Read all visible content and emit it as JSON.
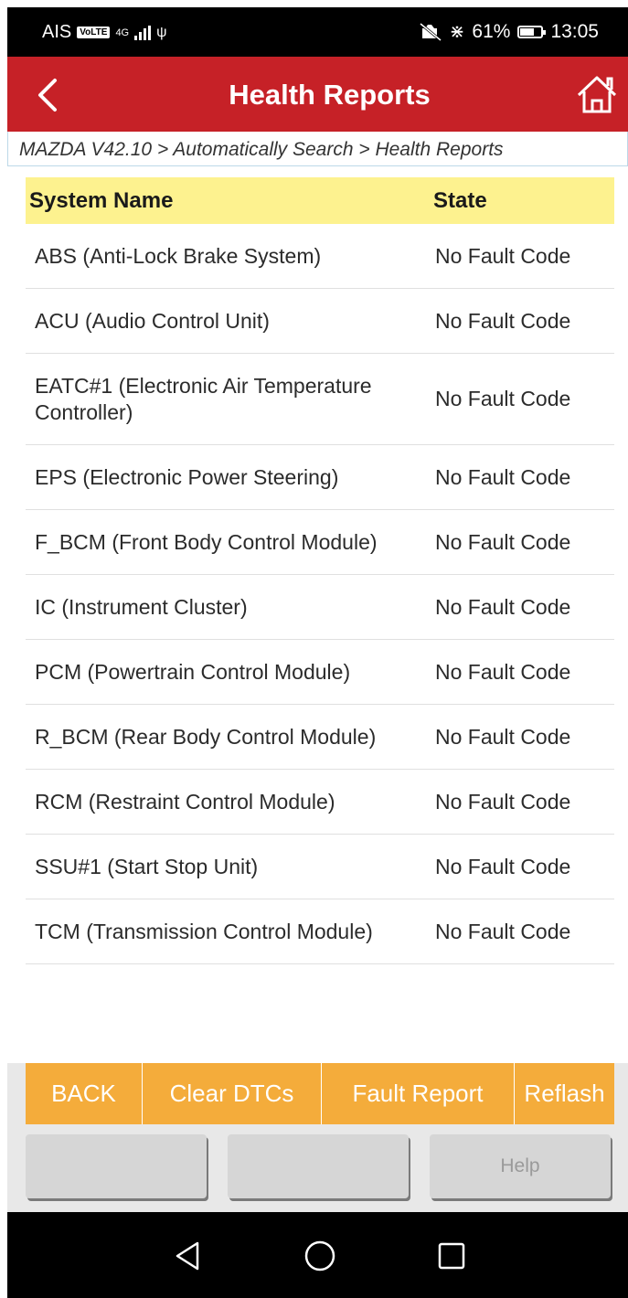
{
  "status_bar": {
    "carrier": "AIS",
    "volte": "VoLTE",
    "network": "4G",
    "battery_percent": "61%",
    "time": "13:05",
    "icons": [
      "signal-icon",
      "usb-debug-icon",
      "mute-icon",
      "bluetooth-icon",
      "battery-icon"
    ]
  },
  "header": {
    "title": "Health Reports",
    "accent_color": "#c62127",
    "icons": [
      "back-arrow-icon",
      "home-icon"
    ]
  },
  "breadcrumb": "MAZDA V42.10 > Automatically Search > Health Reports",
  "table": {
    "headers": {
      "system": "System Name",
      "state": "State"
    },
    "rows": [
      {
        "system": "ABS (Anti-Lock Brake System)",
        "state": "No Fault Code"
      },
      {
        "system": "ACU (Audio Control Unit)",
        "state": "No Fault Code"
      },
      {
        "system": "EATC#1 (Electronic Air Temperature Controller)",
        "state": "No Fault Code"
      },
      {
        "system": "EPS (Electronic Power Steering)",
        "state": "No Fault Code"
      },
      {
        "system": "F_BCM (Front Body Control Module)",
        "state": "No Fault Code"
      },
      {
        "system": "IC (Instrument Cluster)",
        "state": "No Fault Code"
      },
      {
        "system": "PCM (Powertrain Control Module)",
        "state": "No Fault Code"
      },
      {
        "system": "R_BCM (Rear Body Control Module)",
        "state": "No Fault Code"
      },
      {
        "system": "RCM (Restraint Control Module)",
        "state": "No Fault Code"
      },
      {
        "system": "SSU#1 (Start Stop Unit)",
        "state": "No Fault Code"
      },
      {
        "system": "TCM (Transmission Control Module)",
        "state": "No Fault Code"
      }
    ]
  },
  "toolbar": {
    "back": "BACK",
    "clear_dtcs": "Clear DTCs",
    "fault_report": "Fault Report",
    "reflash": "Reflash",
    "blank1": "",
    "blank2": "",
    "help": "Help",
    "button_color": "#f4ac3b"
  },
  "nav_bar": {
    "icons": [
      "nav-back-icon",
      "nav-home-icon",
      "nav-recents-icon"
    ]
  }
}
